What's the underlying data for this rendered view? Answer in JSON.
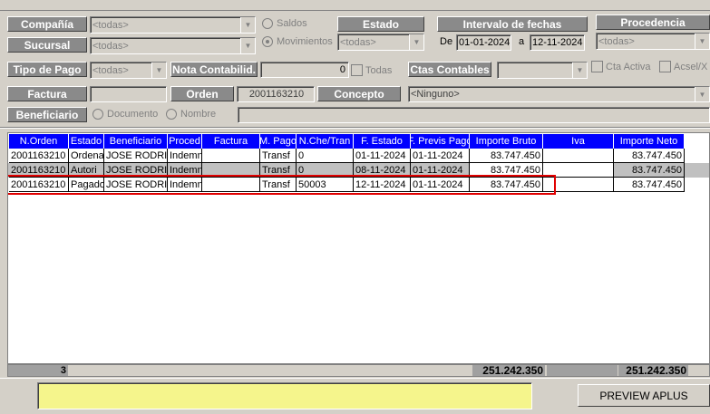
{
  "filters": {
    "compania_label": "Compañía",
    "compania_value": "<todas>",
    "sucursal_label": "Sucursal",
    "sucursal_value": "<todas>",
    "saldos_label": "Saldos",
    "movimientos_label": "Movimientos",
    "estado_label": "Estado",
    "estado_value": "<todas>",
    "intervalo_label": "Intervalo de  fechas",
    "de_label": "De",
    "fecha_desde": "01-01-2024",
    "a_label": "a",
    "fecha_hasta": "12-11-2024",
    "procedencia_label": "Procedencia",
    "procedencia_value": "<todas>",
    "tipo_pago_label": "Tipo de Pago",
    "tipo_pago_value": "<todas>",
    "nota_contab_label": "Nota Contabilid.",
    "nota_contab_value": "0",
    "todas_label": "Todas",
    "ctas_contables_label": "Ctas Contables",
    "ctas_contables_value": "",
    "cta_activa_label": "Cta Activa",
    "acsel_label": "Acsel/X",
    "factura_label": "Factura",
    "factura_value": "",
    "orden_label": "Orden",
    "orden_value": "2001163210",
    "concepto_label": "Concepto",
    "concepto_value": "<Ninguno>",
    "beneficiario_label": "Beneficiario",
    "documento_label": "Documento",
    "nombre_label": "Nombre",
    "beneficiario_value": ""
  },
  "table": {
    "columns": [
      "N.Orden",
      "Estado",
      "Beneficiario",
      "Proced",
      "Factura",
      "M. Pago",
      "N.Che/Tran",
      "F. Estado",
      "F. Previs Pago",
      "Importe Bruto",
      "Iva",
      "Importe Neto"
    ],
    "rows": [
      [
        "2001163210",
        "Ordena",
        "JOSE RODRIGUEZ",
        "Indemn",
        "",
        "Transf",
        "0",
        "01-11-2024",
        "01-11-2024",
        "83.747.450",
        "",
        "83.747.450"
      ],
      [
        "2001163210",
        "Autori",
        "JOSE RODRIGUEZ",
        "Indemn",
        "",
        "Transf",
        "0",
        "08-11-2024",
        "01-11-2024",
        "83.747.450",
        "",
        "83.747.450"
      ],
      [
        "2001163210",
        "Pagado",
        "JOSE RODRIGUEZ",
        "Indemn",
        "",
        "Transf",
        "50003",
        "12-11-2024",
        "01-11-2024",
        "83.747.450",
        "",
        "83.747.450"
      ]
    ],
    "footer_count": "3",
    "footer_bruto": "251.242.350",
    "footer_neto": "251.242.350"
  },
  "bottom": {
    "status_text": "",
    "preview_label": "PREVIEW APLUS"
  },
  "colors": {
    "header_blue": "#0000ff",
    "highlight_red": "#e00000",
    "status_yellow": "#f5f58c"
  }
}
